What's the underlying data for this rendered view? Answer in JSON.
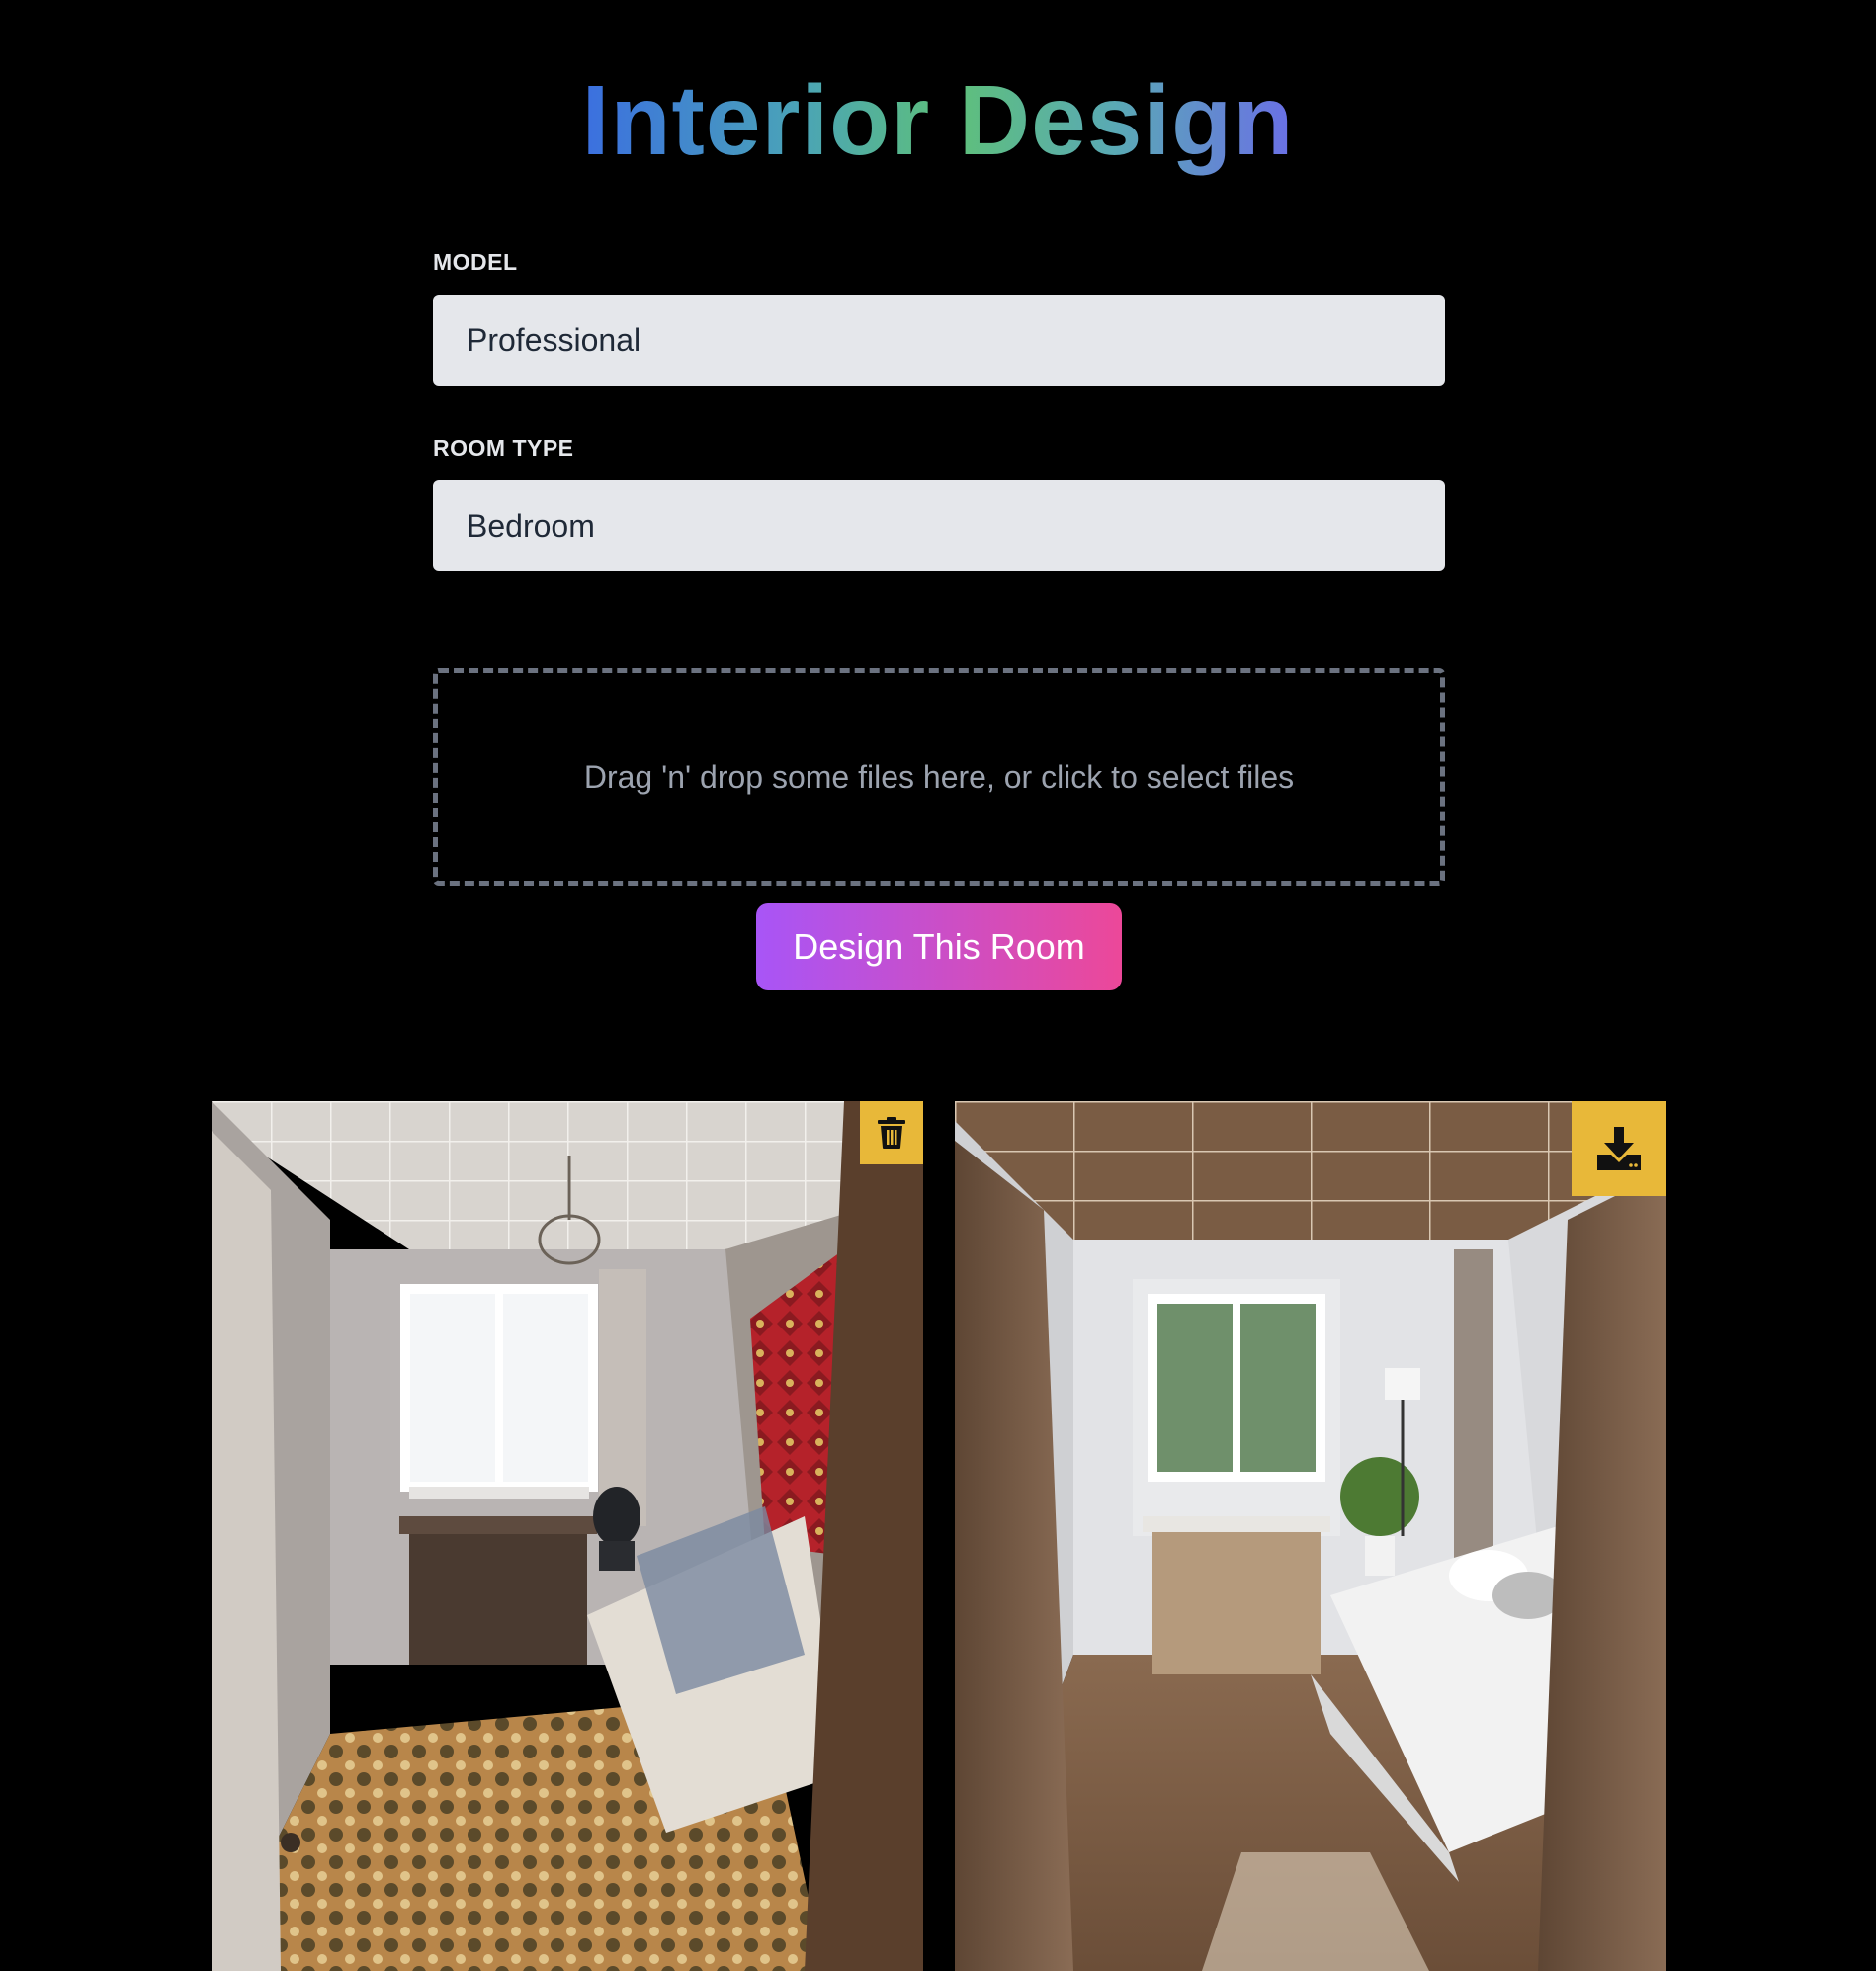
{
  "header": {
    "title": "Interior Design"
  },
  "form": {
    "model": {
      "label": "MODEL",
      "value": "Professional"
    },
    "room_type": {
      "label": "ROOM TYPE",
      "value": "Bedroom"
    },
    "dropzone": {
      "text": "Drag 'n' drop some files here, or click to select files"
    },
    "submit_label": "Design This Room"
  },
  "results": {
    "original": {
      "icon": "trash-icon"
    },
    "generated": {
      "icon": "download-icon"
    }
  },
  "colors": {
    "background": "#000000",
    "field_bg": "#e5e7eb",
    "action_icon_bg": "#e8b839",
    "button_gradient_start": "#a855f7",
    "button_gradient_end": "#ec4899"
  }
}
